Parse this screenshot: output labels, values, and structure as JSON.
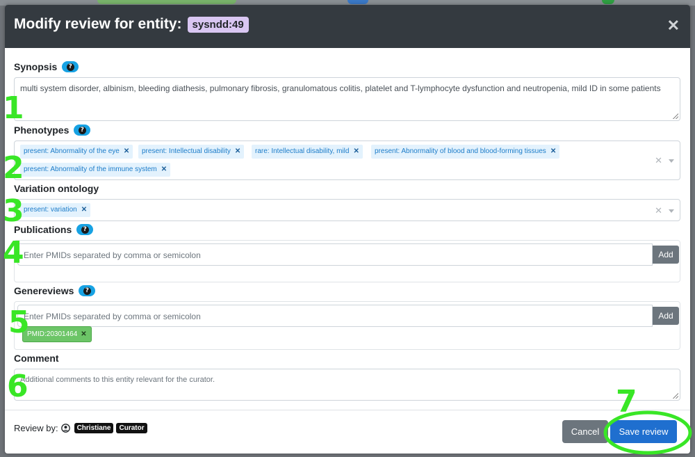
{
  "header": {
    "title": "Modify review for entity:",
    "entity_id": "sysndd:49"
  },
  "synopsis": {
    "label": "Synopsis",
    "value": "multi system disorder, albinism, bleeding diathesis, pulmonary fibrosis, granulomatous colitis, platelet and T-lymphocyte dysfunction and neutropenia, mild ID in some patients"
  },
  "phenotypes": {
    "label": "Phenotypes",
    "tags": [
      "present: Abnormality of the eye",
      "present: Intellectual disability",
      "rare: Intellectual disability, mild",
      "present: Abnormality of blood and blood-forming tissues",
      "present: Abnormality of the immune system"
    ]
  },
  "variation": {
    "label": "Variation ontology",
    "tags": [
      "present: variation"
    ]
  },
  "publications": {
    "label": "Publications",
    "placeholder": "Enter PMIDs separated by comma or semicolon",
    "add_label": "Add"
  },
  "genereviews": {
    "label": "Genereviews",
    "placeholder": "Enter PMIDs separated by comma or semicolon",
    "add_label": "Add",
    "pmid_tag": "PMID:20301464"
  },
  "comment": {
    "label": "Comment",
    "placeholder": "Additional comments to this entity relevant for the curator."
  },
  "footer": {
    "review_by_label": "Review by:",
    "user_name": "Christiane",
    "user_role": "Curator",
    "cancel_label": "Cancel",
    "save_label": "Save review"
  },
  "annotations": {
    "numbers": [
      "1",
      "2",
      "3",
      "4",
      "5",
      "6",
      "7"
    ],
    "color": "#39e626"
  },
  "colors": {
    "header_bg": "#343a40",
    "entity_badge_bg": "#d9c6f2",
    "tag_bg": "#e3f2fd",
    "pmid_tag_bg": "#6cc567",
    "save_button": "#1f6fcf",
    "cancel_button": "#6c757d",
    "help_badge": "#17a2e3"
  }
}
